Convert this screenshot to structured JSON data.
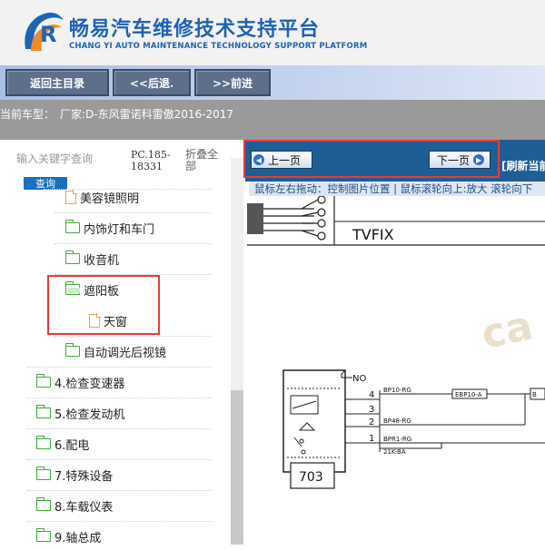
{
  "header": {
    "title_cn": "畅易汽车维修技术支持平台",
    "title_en": "CHANG YI AUTO MAINTENANCE TECHNOLOGY SUPPORT PLATFORM"
  },
  "toolbar": {
    "home_label": "返回主目录",
    "back_label": "<<后退.",
    "forward_label": ">>前进"
  },
  "vehicle": {
    "label": "当前车型：",
    "value": "厂家:D-东风雷诺科雷傲2016-2017"
  },
  "sidebar": {
    "search_placeholder": "输入关键字查询",
    "search_button": "查询",
    "pc_code": "PC.185-18331",
    "collapse_all": "折叠全部",
    "items": [
      {
        "label": "美容镜照明",
        "icon": "document-icon"
      },
      {
        "label": "内饰灯和车门",
        "icon": "folder-icon"
      },
      {
        "label": "收音机",
        "icon": "folder-icon"
      },
      {
        "label": "遮阳板",
        "icon": "folder-open-icon"
      },
      {
        "label": "天窗",
        "icon": "document-icon"
      },
      {
        "label": "自动调光后视镜",
        "icon": "folder-icon"
      },
      {
        "label": "4.检查变速器",
        "icon": "folder-icon"
      },
      {
        "label": "5.检查发动机",
        "icon": "folder-icon"
      },
      {
        "label": "6.配电",
        "icon": "folder-icon"
      },
      {
        "label": "7.特殊设备",
        "icon": "folder-icon"
      },
      {
        "label": "8.车载仪表",
        "icon": "folder-icon"
      },
      {
        "label": "9.轴总成",
        "icon": "folder-icon"
      }
    ]
  },
  "viewer": {
    "prev_label": "上一页",
    "next_label": "下一页",
    "refresh_label": "[刷新当前",
    "hint": "鼠标左右拖动：控制图片位置 | 鼠标滚轮向上:放大  滚轮向下"
  },
  "diagram": {
    "connector_name": "TVFIX",
    "no_label": "NO",
    "component_number": "703",
    "watermark": "ca",
    "pins": [
      "4",
      "3",
      "2",
      "1"
    ],
    "wires": [
      "BP10-RG",
      "BP48-RG",
      "BPR1-RG",
      "21K-BA"
    ],
    "splice": "EBP10-A",
    "right_cut": "B"
  },
  "colors": {
    "brand_blue": "#1e63b4",
    "nav_blue": "#1f5d97",
    "highlight_red": "#e53b3b",
    "folder_green": "#3cac3c",
    "doc_orange": "#f0a24a"
  }
}
